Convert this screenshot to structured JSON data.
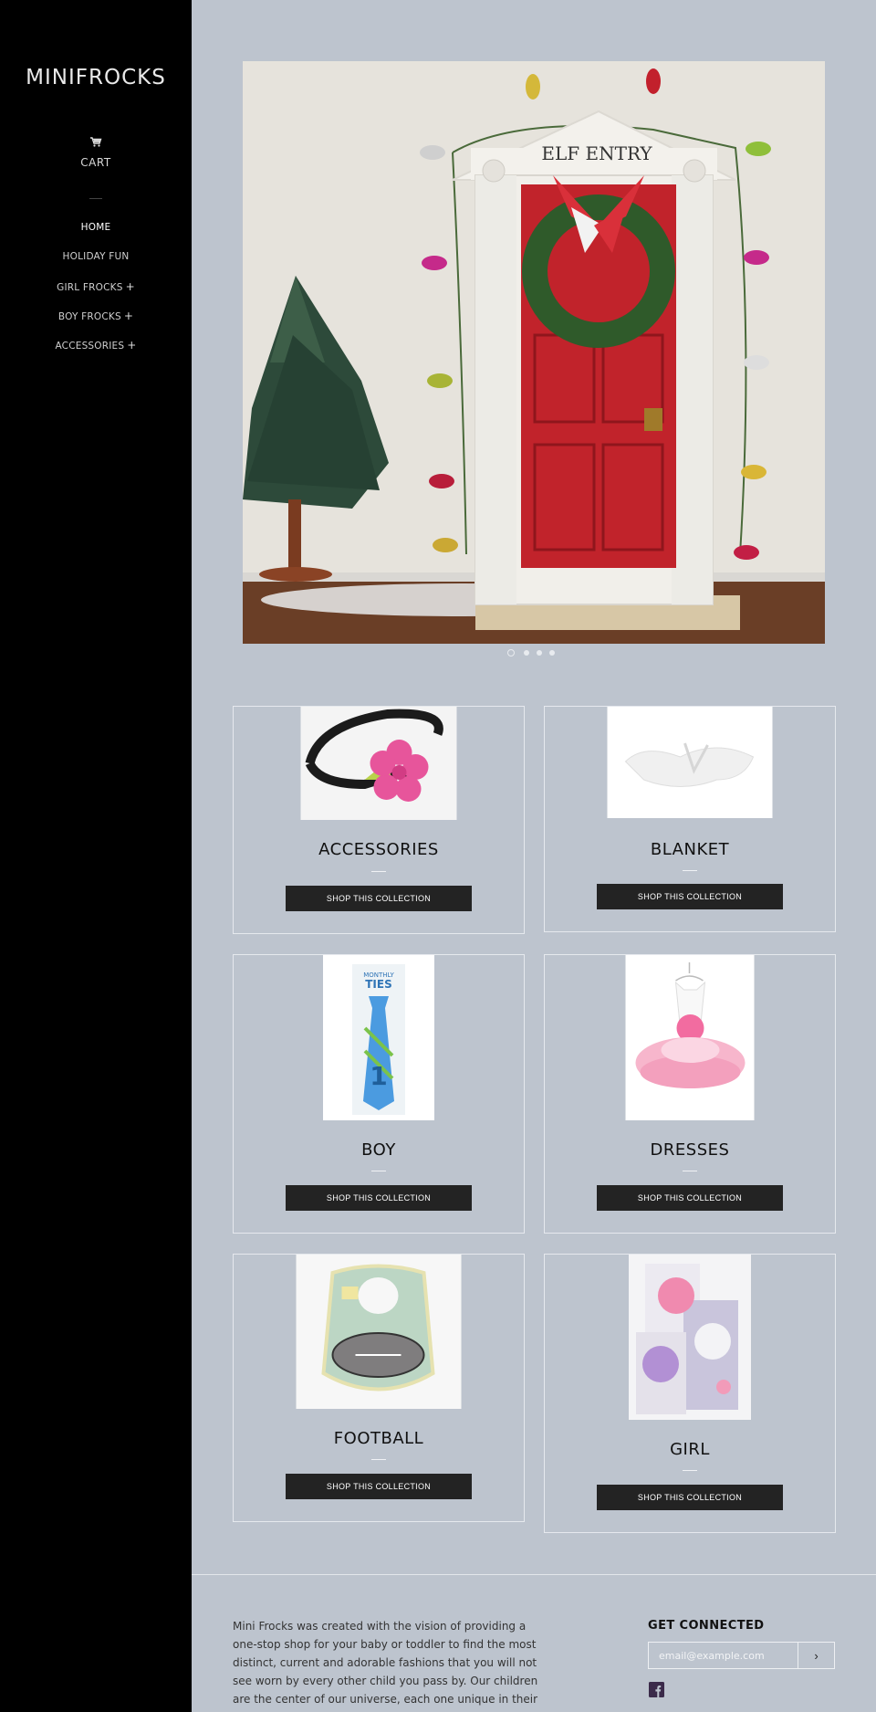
{
  "sidebar": {
    "brand": "MINIFROCKS",
    "cart_label": "CART",
    "cart_icon": "cart-icon",
    "nav": [
      {
        "label": "HOME",
        "has_submenu": false
      },
      {
        "label": "HOLIDAY FUN",
        "has_submenu": false
      },
      {
        "label": "GIRL FROCKS",
        "has_submenu": true
      },
      {
        "label": "BOY FROCKS",
        "has_submenu": true
      },
      {
        "label": "ACCESSORIES",
        "has_submenu": true
      }
    ],
    "submenu_symbol": "+"
  },
  "hero": {
    "door_sign": "ELF ENTRY",
    "slides_total": 4,
    "active_slide": 1
  },
  "collections": [
    {
      "title": "ACCESSORIES",
      "button": "SHOP THIS COLLECTION"
    },
    {
      "title": "BLANKET",
      "button": "SHOP THIS COLLECTION"
    },
    {
      "title": "BOY",
      "button": "SHOP THIS COLLECTION"
    },
    {
      "title": "DRESSES",
      "button": "SHOP THIS COLLECTION"
    },
    {
      "title": "FOOTBALL",
      "button": "SHOP THIS COLLECTION"
    },
    {
      "title": "GIRL",
      "button": "SHOP THIS COLLECTION"
    }
  ],
  "footer": {
    "about_lines": [
      "Mini Frocks was created with the vision of providing a",
      "one-stop shop for your baby or toddler to find the most",
      "distinct, current and adorable fashions that you will not",
      "see worn by every other child you pass by. Our children",
      "are the center of our universe, each one unique in their"
    ],
    "get_connected": "GET CONNECTED",
    "email_placeholder": "email@example.com",
    "submit_symbol": "›",
    "social_icon": "facebook-icon"
  },
  "colors": {
    "page_bg": "#bdc4ce",
    "sidebar_bg": "#000000",
    "button_bg": "#232323",
    "facebook": "#3b2a4a"
  }
}
